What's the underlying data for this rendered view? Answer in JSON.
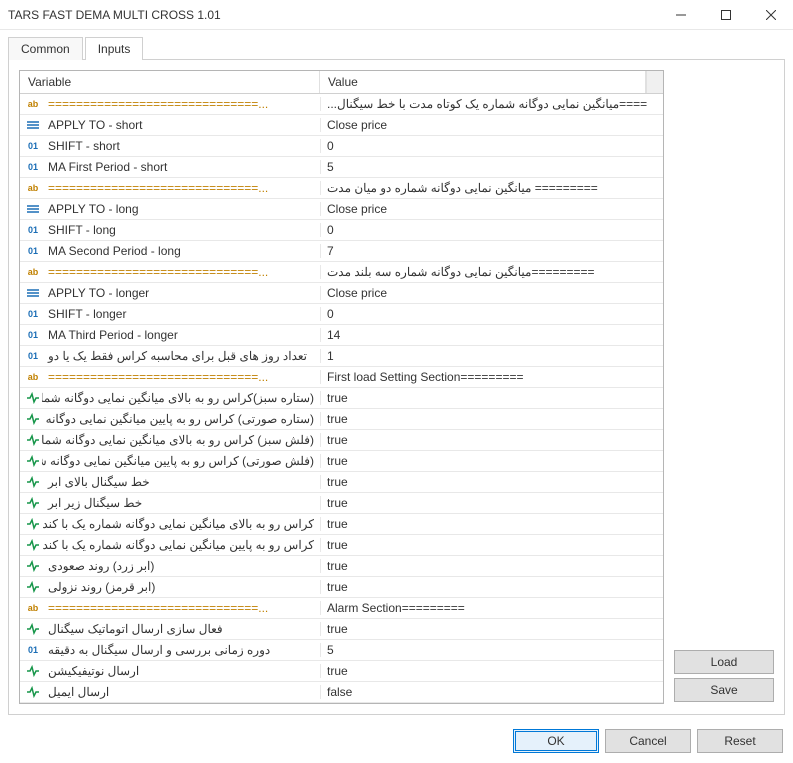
{
  "window": {
    "title": "TARS FAST DEMA MULTI CROSS 1.01"
  },
  "tabs": {
    "common": "Common",
    "inputs": "Inputs"
  },
  "headers": {
    "variable": "Variable",
    "value": "Value"
  },
  "rows": [
    {
      "t": "ab",
      "v": "==============================...",
      "val": "====میانگین نمایی دوگانه شماره یک کوتاه مدت با خط سیگنال..."
    },
    {
      "t": "enm",
      "v": "APPLY TO - short",
      "val": "Close price"
    },
    {
      "t": "01",
      "v": "SHIFT - short",
      "val": "0"
    },
    {
      "t": "01",
      "v": "MA First Period - short",
      "val": "5"
    },
    {
      "t": "ab",
      "v": "==============================...",
      "val": "========= میانگین نمایی دوگانه شماره دو میان مدت"
    },
    {
      "t": "enm",
      "v": "APPLY TO - long",
      "val": "Close price"
    },
    {
      "t": "01",
      "v": "SHIFT  - long",
      "val": "0"
    },
    {
      "t": "01",
      "v": "MA Second Period - long",
      "val": "7"
    },
    {
      "t": "ab",
      "v": "==============================...",
      "val": "=========میانگین نمایی دوگانه شماره سه بلند مدت"
    },
    {
      "t": "enm",
      "v": "APPLY TO  - longer",
      "val": "Close price"
    },
    {
      "t": "01",
      "v": "SHIFT  - longer",
      "val": "0"
    },
    {
      "t": "01",
      "v": "MA Third Period - longer",
      "val": "14"
    },
    {
      "t": "01",
      "v": "تعداد روز های قبل برای محاسبه کراس فقط یک یا دو",
      "val": "1"
    },
    {
      "t": "ab",
      "v": "==============================...",
      "val": "First load Setting Section========="
    },
    {
      "t": "bool",
      "v": "(ستاره سبز)کراس رو به بالای میانگین نمایی دوگانه شماره...",
      "val": "true"
    },
    {
      "t": "bool",
      "v": "(ستاره صورتی) کراس رو به پایین میانگین نمایی دوگانه شمار...",
      "val": "true"
    },
    {
      "t": "bool",
      "v": "(فلش سبز) کراس رو به بالای میانگین نمایی دوگانه شماره د...",
      "val": "true"
    },
    {
      "t": "bool",
      "v": "(فلش صورتی) کراس رو به پایین میانگین نمایی دوگانه شماره...",
      "val": "true"
    },
    {
      "t": "bool",
      "v": "خط سیگنال بالای ابر",
      "val": "true"
    },
    {
      "t": "bool",
      "v": "خط سیگنال زیر ابر",
      "val": "true"
    },
    {
      "t": "bool",
      "v": "کراس رو به بالای میانگین نمایی دوگانه شماره یک با کندل",
      "val": "true"
    },
    {
      "t": "bool",
      "v": "کراس رو به پایین میانگین نمایی دوگانه شماره یک با کندل",
      "val": "true"
    },
    {
      "t": "bool",
      "v": "(ابر زرد) روند صعودی",
      "val": "true"
    },
    {
      "t": "bool",
      "v": "(ابر قرمز) روند نزولی",
      "val": "true"
    },
    {
      "t": "ab",
      "v": "==============================...",
      "val": "Alarm Section========="
    },
    {
      "t": "bool",
      "v": "فعال سازی ارسال اتوماتیک سیگنال",
      "val": "true"
    },
    {
      "t": "01",
      "v": "دوره زمانی بررسی و ارسال سیگنال به دقیقه",
      "val": "5"
    },
    {
      "t": "bool",
      "v": "ارسال نوتیفیکیشن",
      "val": "true"
    },
    {
      "t": "bool",
      "v": "ارسال ایمیل",
      "val": "false"
    }
  ],
  "side": {
    "load": "Load",
    "save": "Save"
  },
  "footer": {
    "ok": "OK",
    "cancel": "Cancel",
    "reset": "Reset"
  }
}
